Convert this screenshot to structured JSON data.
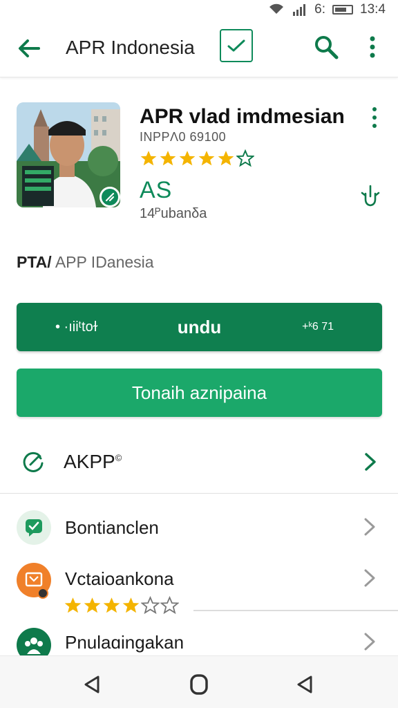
{
  "status_bar": {
    "text": "6:  13:4",
    "time": "13:4"
  },
  "app_bar": {
    "title": "APR Indonesia"
  },
  "app": {
    "name": "APR vlad imdmesian",
    "id": "INPPΛ0 69100",
    "rating_filled": 5,
    "rating_outline": 1,
    "rating_code": "AS",
    "downloads": "14ᴾubanδa"
  },
  "developer": {
    "prefix": "PTA/",
    "name": "APP IDanesia"
  },
  "buttons": {
    "primary_left": "• ·ıiiᵗtoɫ",
    "primary_label": "undu",
    "primary_right": "+ᵏ6 71",
    "secondary_label": "Tonaih aznipaina"
  },
  "akpp": {
    "label": "AKPP",
    "superscript": "©"
  },
  "list": [
    {
      "label": "Bontianclen",
      "icon": "message-check-icon",
      "color": "#1d9a5d"
    },
    {
      "label": "Vctaioankona",
      "icon": "document-badge-icon",
      "color": "#f0802a",
      "stars_filled": 4,
      "stars_empty": 2
    },
    {
      "label": "Pnulaɑingakan",
      "icon": "group-icon",
      "color": "#0e7a4b"
    }
  ],
  "colors": {
    "accent": "#0f7f4f",
    "accent_light": "#1ba86a",
    "star": "#f4b400"
  }
}
